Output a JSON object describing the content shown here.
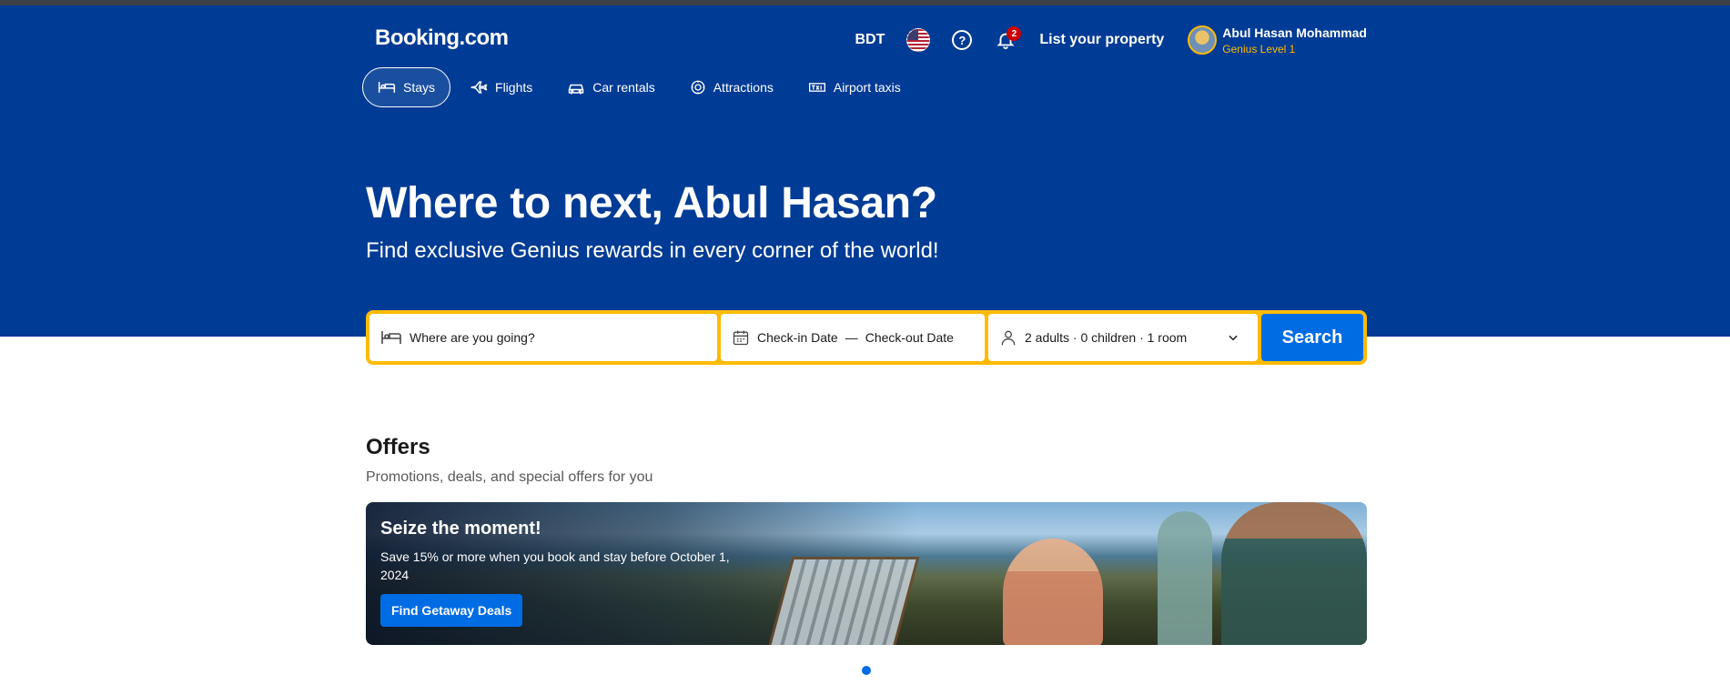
{
  "header": {
    "logo": "Booking.com",
    "currency": "BDT",
    "notification_count": "2",
    "list_property": "List your property",
    "user_name": "Abul Hasan Mohammad",
    "user_level": "Genius Level 1"
  },
  "nav": {
    "tabs": [
      {
        "label": "Stays",
        "icon": "bed-icon",
        "active": true
      },
      {
        "label": "Flights",
        "icon": "plane-icon",
        "active": false
      },
      {
        "label": "Car rentals",
        "icon": "car-icon",
        "active": false
      },
      {
        "label": "Attractions",
        "icon": "attractions-icon",
        "active": false
      },
      {
        "label": "Airport taxis",
        "icon": "taxi-icon",
        "active": false
      }
    ]
  },
  "hero": {
    "title": "Where to next, Abul Hasan?",
    "subtitle": "Find exclusive Genius rewards in every corner of the world!"
  },
  "search": {
    "destination_placeholder": "Where are you going?",
    "checkin": "Check-in Date",
    "separator": "—",
    "checkout": "Check-out Date",
    "occupancy": "2 adults · 0 children · 1 room",
    "button": "Search"
  },
  "offers": {
    "title": "Offers",
    "subtitle": "Promotions, deals, and special offers for you",
    "card": {
      "title": "Seize the moment!",
      "text": "Save 15% or more when you book and stay before October 1, 2024",
      "button": "Find Getaway Deals"
    }
  },
  "colors": {
    "brand_blue": "#003b95",
    "accent_yellow": "#febb02",
    "action_blue": "#006ce4"
  }
}
